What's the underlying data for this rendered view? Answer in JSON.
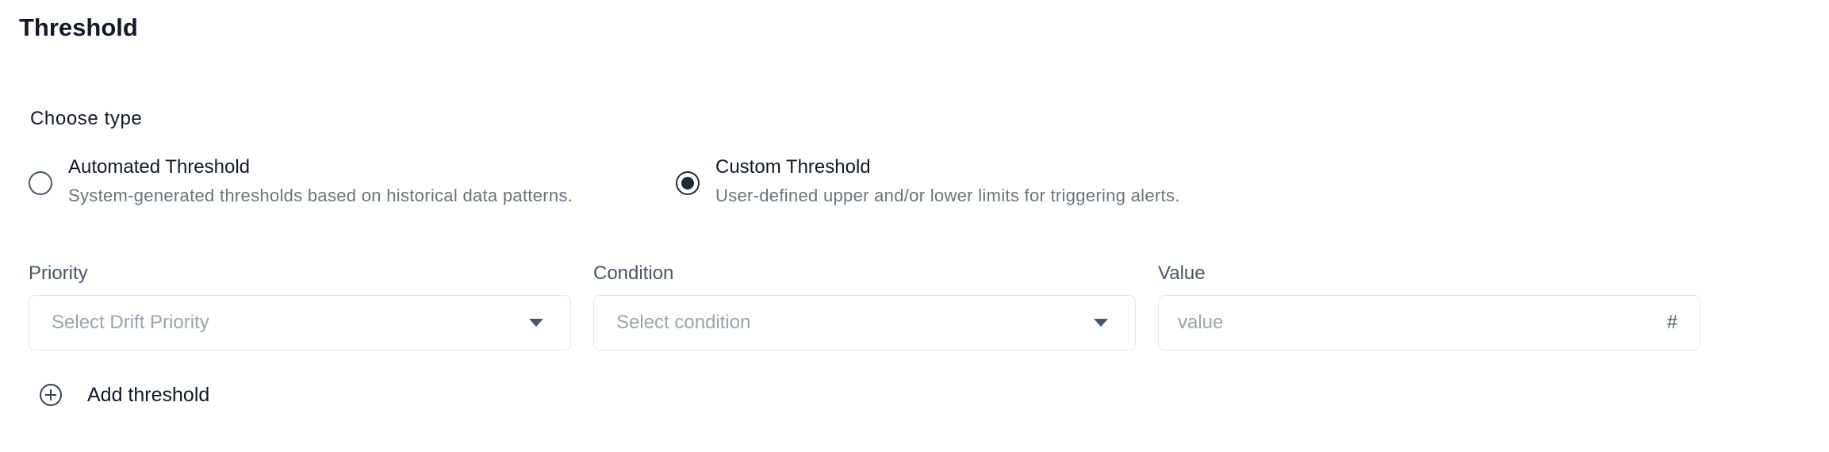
{
  "title": "Threshold",
  "choose_type": {
    "label": "Choose type",
    "options": [
      {
        "title": "Automated Threshold",
        "description": "System-generated thresholds based on historical data patterns.",
        "selected": false
      },
      {
        "title": "Custom Threshold",
        "description": "User-defined upper and/or lower limits for triggering alerts.",
        "selected": true
      }
    ]
  },
  "fields": {
    "priority": {
      "label": "Priority",
      "placeholder": "Select Drift Priority"
    },
    "condition": {
      "label": "Condition",
      "placeholder": "Select condition"
    },
    "value": {
      "label": "Value",
      "placeholder": "value",
      "suffix": "#"
    }
  },
  "add_threshold": {
    "label": "Add threshold",
    "icon": "plus-circle-icon"
  },
  "colors": {
    "text": "#111827",
    "muted": "#6b7280",
    "placeholder": "#9ca3af",
    "border": "#e5e7eb"
  }
}
